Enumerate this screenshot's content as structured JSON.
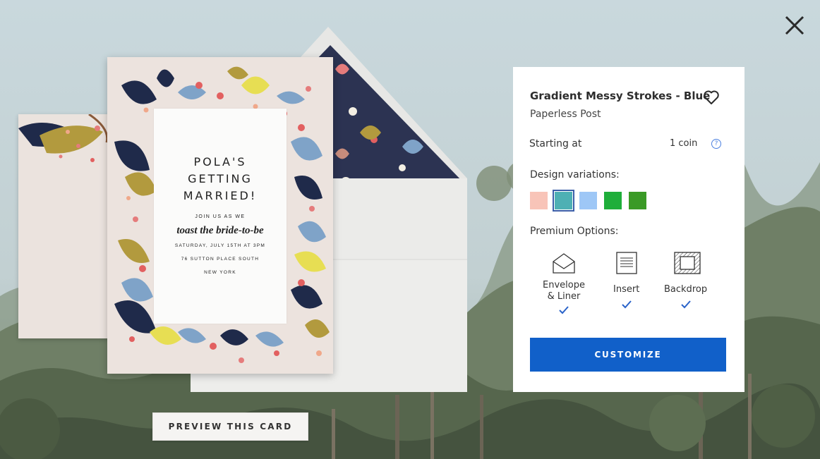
{
  "close": {
    "icon": "close-icon"
  },
  "card": {
    "title": "POLA'S\nGETTING\nMARRIED!",
    "join": "JOIN US AS WE",
    "toast": "toast the bride-to-be",
    "date": "SATURDAY, JULY 15TH AT 3PM",
    "address": "76 SUTTON PLACE SOUTH",
    "city": "NEW YORK"
  },
  "preview_button": "PREVIEW THIS CARD",
  "panel": {
    "title": "Gradient Messy Strokes - Blue",
    "brand": "Paperless Post",
    "starting_at": "Starting at",
    "price": "1 coin",
    "help": "?",
    "variations_label": "Design variations:",
    "swatches": [
      {
        "color": "#f8c4b8",
        "selected": false
      },
      {
        "color": "#4eb0b4",
        "selected": true
      },
      {
        "color": "#9ec7f6",
        "selected": false
      },
      {
        "color": "#1fae3a",
        "selected": false
      },
      {
        "color": "#3a9a26",
        "selected": false
      }
    ],
    "premium_label": "Premium Options:",
    "options": [
      {
        "label": "Envelope\n& Liner",
        "icon": "envelope-icon",
        "checked": true
      },
      {
        "label": "Insert",
        "icon": "insert-icon",
        "checked": true
      },
      {
        "label": "Backdrop",
        "icon": "backdrop-icon",
        "checked": true
      }
    ],
    "customize": "CUSTOMIZE"
  },
  "colors": {
    "accent": "#1160c9",
    "check": "#2a63c9"
  }
}
